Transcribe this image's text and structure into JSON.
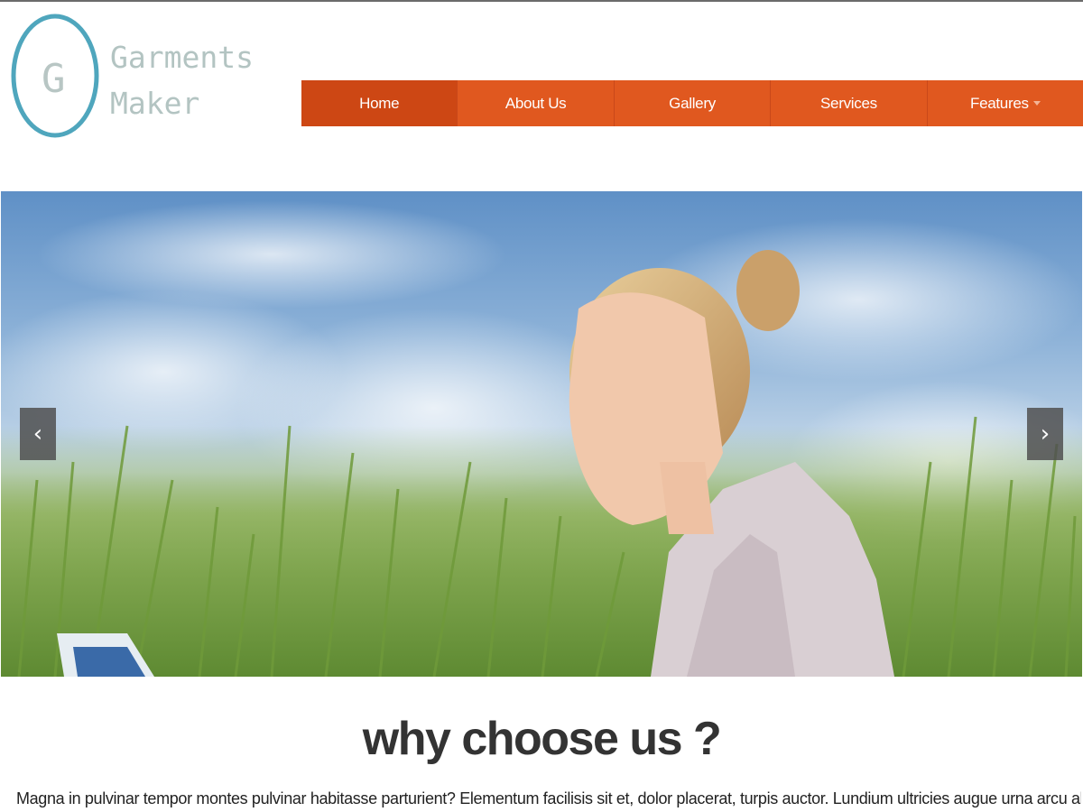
{
  "logo": {
    "letter": "G",
    "line1": "Garments",
    "line2": "Maker"
  },
  "nav": {
    "items": [
      {
        "label": "Home",
        "active": true
      },
      {
        "label": "About Us"
      },
      {
        "label": "Gallery"
      },
      {
        "label": "Services"
      },
      {
        "label": "Features",
        "has_dropdown": true
      }
    ]
  },
  "hero": {
    "prev_icon": "‹",
    "next_icon": "›"
  },
  "why": {
    "title": "why choose us ?",
    "text": "Magna in pulvinar tempor montes pulvinar habitasse parturient? Elementum facilisis sit et, dolor placerat, turpis auctor. Lundium ultricies augue urna arcu aliquet"
  },
  "colors": {
    "nav_bg": "#e0581f",
    "nav_active": "#cd4714",
    "logo_ring": "#4fa6bd"
  }
}
